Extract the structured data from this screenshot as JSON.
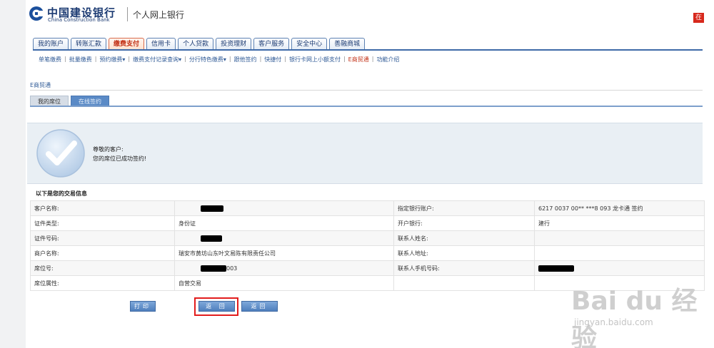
{
  "header": {
    "bank_name_cn": "中国建设银行",
    "bank_name_en": "China Construction Bank",
    "product_name": "个人网上银行",
    "corner_badge": "在"
  },
  "main_tabs": [
    {
      "label": "我的账户",
      "active": false
    },
    {
      "label": "转账汇款",
      "active": false
    },
    {
      "label": "缴费支付",
      "active": true
    },
    {
      "label": "信用卡",
      "active": false
    },
    {
      "label": "个人贷款",
      "active": false
    },
    {
      "label": "投资理财",
      "active": false
    },
    {
      "label": "客户服务",
      "active": false
    },
    {
      "label": "安全中心",
      "active": false
    },
    {
      "label": "善融商城",
      "active": false
    }
  ],
  "sub_nav": [
    {
      "label": "单笔缴费",
      "active": false
    },
    {
      "label": "批量缴费",
      "active": false
    },
    {
      "label": "预约缴费▾",
      "active": false
    },
    {
      "label": "缴费支付记录查询▾",
      "active": false
    },
    {
      "label": "分行特色缴费▾",
      "active": false
    },
    {
      "label": "跟他签约",
      "active": false
    },
    {
      "label": "快捷付",
      "active": false
    },
    {
      "label": "银行卡网上小额支付",
      "active": false
    },
    {
      "label": "E商贸通",
      "active": true
    },
    {
      "label": "功能介绍",
      "active": false
    }
  ],
  "section_title": "E商贸通",
  "inner_tabs": [
    {
      "label": "我的席位",
      "active": false
    },
    {
      "label": "在线签约",
      "active": true
    }
  ],
  "success": {
    "line1": "尊敬的客户:",
    "line2": "您的席位已成功签约!"
  },
  "table": {
    "title": "以下是您的交易信息",
    "rows": [
      {
        "l1": "客户名称:",
        "v1": "",
        "v1_redacted": true,
        "l2": "指定银行账户:",
        "v2": "6217 0037 00** ***8 093 龙卡通 签约",
        "v2_redacted": false
      },
      {
        "l1": "证件类型:",
        "v1": "身份证",
        "v1_redacted": false,
        "l2": "开户银行:",
        "v2": "建行",
        "v2_redacted": false
      },
      {
        "l1": "证件号码:",
        "v1": "",
        "v1_redacted": true,
        "l2": "联系人姓名:",
        "v2": "",
        "v2_redacted": false
      },
      {
        "l1": "商户名称:",
        "v1": "瑞安市黄坊山东叶文易陈有限责任公司",
        "v1_redacted": false,
        "l2": "联系人地址:",
        "v2": "",
        "v2_redacted": false
      },
      {
        "l1": "席位号:",
        "v1": "003",
        "v1_redacted": true,
        "l2": "联系人手机号码:",
        "v2": "",
        "v2_redacted": true
      },
      {
        "l1": "席位属性:",
        "v1": "自营交易",
        "v1_redacted": false,
        "l2": "",
        "v2": "",
        "v2_redacted": false
      }
    ]
  },
  "buttons": {
    "print": "打印",
    "return": "返 回",
    "back": "返回"
  },
  "watermark": {
    "brand": "Bai du 经验",
    "url": "jingyan.baidu.com"
  }
}
